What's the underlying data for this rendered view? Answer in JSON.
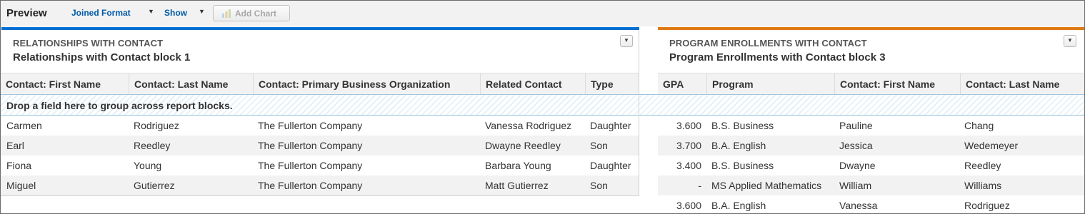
{
  "toolbar": {
    "title": "Preview",
    "joined_format_label": "Joined Format",
    "show_label": "Show",
    "caret_icon": "▼",
    "add_chart_label": "Add Chart"
  },
  "colors": {
    "left_block_accent": "#0070d2",
    "right_block_accent": "#e07a16",
    "link": "#015ba7"
  },
  "dropzone": {
    "text": "Drop a field here to group across report blocks."
  },
  "left_block": {
    "kicker": "RELATIONSHIPS WITH CONTACT",
    "title": "Relationships with Contact block 1",
    "columns": [
      "Contact: First Name",
      "Contact: Last Name",
      "Contact: Primary Business Organization",
      "Related Contact",
      "Type"
    ],
    "rows": [
      [
        "Carmen",
        "Rodriguez",
        "The Fullerton Company",
        "Vanessa Rodriguez",
        "Daughter"
      ],
      [
        "Earl",
        "Reedley",
        "The Fullerton Company",
        "Dwayne Reedley",
        "Son"
      ],
      [
        "Fiona",
        "Young",
        "The Fullerton Company",
        "Barbara Young",
        "Daughter"
      ],
      [
        "Miguel",
        "Gutierrez",
        "The Fullerton Company",
        "Matt Gutierrez",
        "Son"
      ]
    ]
  },
  "right_block": {
    "kicker": "PROGRAM ENROLLMENTS WITH CONTACT",
    "title": "Program Enrollments with Contact block 3",
    "columns": [
      "GPA",
      "Program",
      "Contact: First Name",
      "Contact: Last Name"
    ],
    "rows": [
      [
        "3.600",
        "B.S. Business",
        "Pauline",
        "Chang"
      ],
      [
        "3.700",
        "B.A. English",
        "Jessica",
        "Wedemeyer"
      ],
      [
        "3.400",
        "B.S. Business",
        "Dwayne",
        "Reedley"
      ],
      [
        "-",
        "MS Applied Mathematics",
        "William",
        "Williams"
      ],
      [
        "3.600",
        "B.A. English",
        "Vanessa",
        "Rodriguez"
      ]
    ]
  }
}
